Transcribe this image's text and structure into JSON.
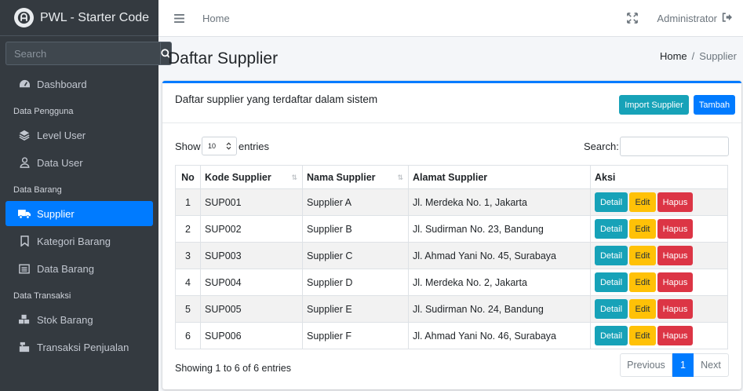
{
  "brand": {
    "title": "PWL - Starter Code"
  },
  "sidebar": {
    "search_placeholder": "Search",
    "dashboard": "Dashboard",
    "header_pengguna": "Data Pengguna",
    "level_user": "Level User",
    "data_user": "Data User",
    "header_barang": "Data Barang",
    "supplier": "Supplier",
    "kategori_barang": "Kategori Barang",
    "data_barang": "Data Barang",
    "header_transaksi": "Data Transaksi",
    "stok_barang": "Stok Barang",
    "transaksi_penjualan": "Transaksi Penjualan"
  },
  "navbar": {
    "home": "Home",
    "user": "Administrator"
  },
  "content": {
    "page_title": "Daftar Supplier",
    "breadcrumb_home": "Home",
    "breadcrumb_sep": "/",
    "breadcrumb_active": "Supplier"
  },
  "card": {
    "title": "Daftar supplier yang terdaftar dalam sistem",
    "import_label": "Import Supplier",
    "tambah_label": "Tambah"
  },
  "datatable": {
    "show_label": "Show",
    "entries_value": "10",
    "entries_label": "entries",
    "search_label": "Search:",
    "columns": [
      "No",
      "Kode Supplier",
      "Nama Supplier",
      "Alamat Supplier",
      "Aksi"
    ],
    "rows": [
      {
        "no": "1",
        "kode": "SUP001",
        "nama": "Supplier A",
        "alamat": "Jl. Merdeka No. 1, Jakarta"
      },
      {
        "no": "2",
        "kode": "SUP002",
        "nama": "Supplier B",
        "alamat": "Jl. Sudirman No. 23, Bandung"
      },
      {
        "no": "3",
        "kode": "SUP003",
        "nama": "Supplier C",
        "alamat": "Jl. Ahmad Yani No. 45, Surabaya"
      },
      {
        "no": "4",
        "kode": "SUP004",
        "nama": "Supplier D",
        "alamat": "Jl. Merdeka No. 2, Jakarta"
      },
      {
        "no": "5",
        "kode": "SUP005",
        "nama": "Supplier E",
        "alamat": "Jl. Sudirman No. 24, Bandung"
      },
      {
        "no": "6",
        "kode": "SUP006",
        "nama": "Supplier F",
        "alamat": "Jl. Ahmad Yani No. 46, Surabaya"
      }
    ],
    "actions": {
      "detail": "Detail",
      "edit": "Edit",
      "hapus": "Hapus"
    },
    "info": "Showing 1 to 6 of 6 entries",
    "pagination": {
      "prev": "Previous",
      "page": "1",
      "next": "Next"
    }
  },
  "colors": {
    "primary": "#007bff",
    "info": "#17a2b8",
    "warning": "#ffc107",
    "danger": "#dc3545",
    "sidebar": "#343a40"
  }
}
